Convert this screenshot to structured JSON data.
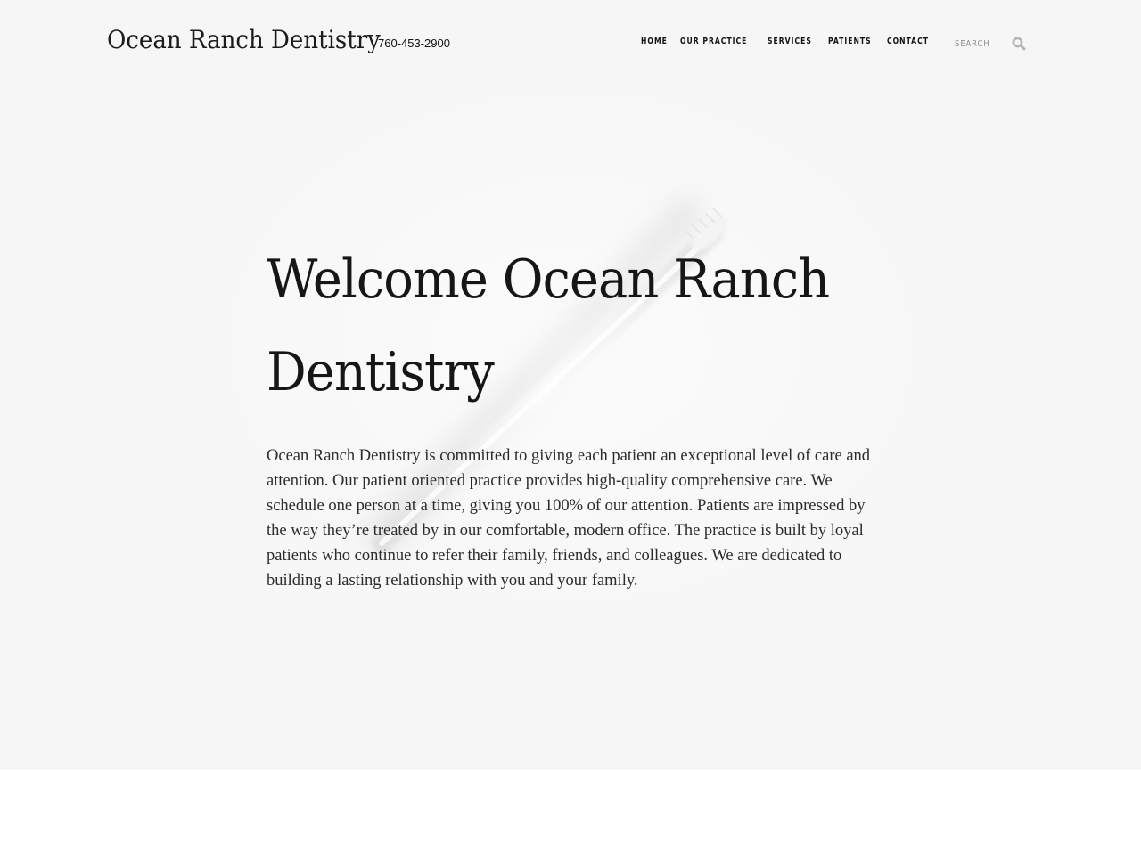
{
  "site": {
    "name": "Ocean Ranch Dentistry",
    "phone": "760-453-2900"
  },
  "nav": {
    "items": [
      {
        "label": "HOME"
      },
      {
        "label": "OUR PRACTICE"
      },
      {
        "label": "SERVICES"
      },
      {
        "label": "PATIENTS"
      },
      {
        "label": "CONTACT"
      }
    ]
  },
  "search": {
    "placeholder": "SEARCH",
    "icon": "search-icon"
  },
  "hero": {
    "title": "Welcome Ocean Ranch Dentistry",
    "body": "Ocean Ranch Dentistry is committed to giving each patient an exceptional level of care and attention. Our patient oriented practice provides high-quality comprehensive care. We schedule one person at a time, giving you 100% of our attention. Patients are impressed by the way they’re treated by in our comfortable, modern office. The practice is built by loyal patients who continue to refer their family, friends, and colleagues. We are dedicated to building a lasting relationship with you and your family."
  },
  "colors": {
    "hero_background": "#f6f6f6",
    "text": "#161616",
    "page_background": "#ffffff"
  }
}
